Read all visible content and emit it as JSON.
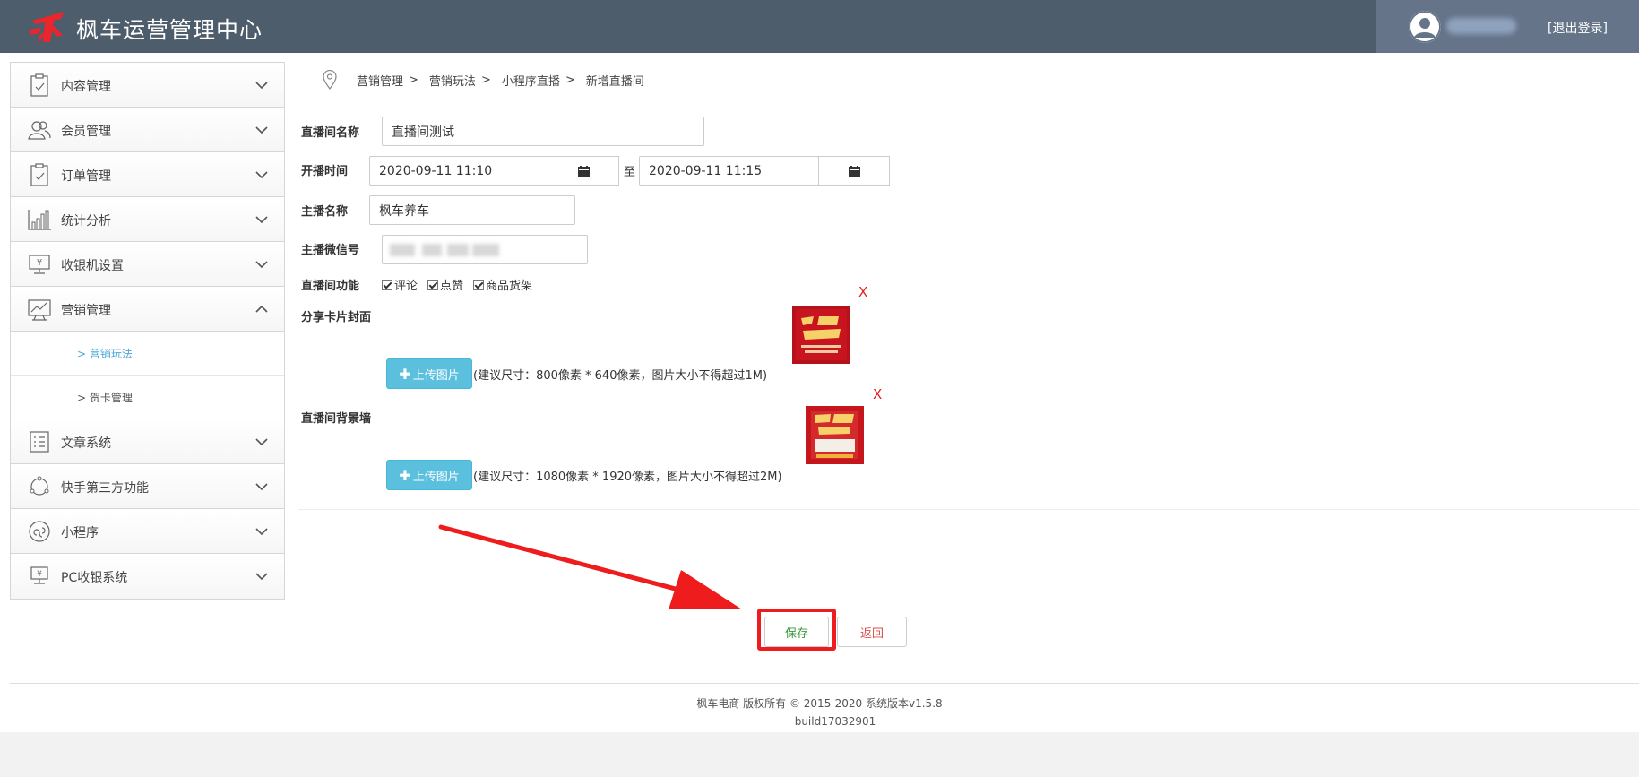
{
  "header": {
    "app_title": "枫车运营管理中心",
    "logout": "[退出登录]"
  },
  "sidebar": {
    "items": [
      {
        "label": "内容管理",
        "icon": "clipboard-check-icon",
        "expanded": false
      },
      {
        "label": "会员管理",
        "icon": "users-icon",
        "expanded": false
      },
      {
        "label": "订单管理",
        "icon": "clipboard-check-icon",
        "expanded": false
      },
      {
        "label": "统计分析",
        "icon": "bar-chart-icon",
        "expanded": false
      },
      {
        "label": "收银机设置",
        "icon": "cash-register-icon",
        "expanded": false
      },
      {
        "label": "营销管理",
        "icon": "trend-chart-icon",
        "expanded": true
      },
      {
        "label": "文章系统",
        "icon": "list-icon",
        "expanded": false
      },
      {
        "label": "快手第三方功能",
        "icon": "cycle-icon",
        "expanded": false
      },
      {
        "label": "小程序",
        "icon": "mini-program-icon",
        "expanded": false
      },
      {
        "label": "PC收银系统",
        "icon": "pc-cash-icon",
        "expanded": false
      }
    ],
    "submenu": [
      {
        "label": "> 营销玩法",
        "active": true
      },
      {
        "label": "> 贺卡管理",
        "active": false
      }
    ]
  },
  "breadcrumb": [
    "营销管理",
    "营销玩法",
    "小程序直播",
    "新增直播间"
  ],
  "breadcrumb_sep": ">",
  "form": {
    "room_name_label": "直播间名称",
    "room_name_value": "直播间测试",
    "start_time_label": "开播时间",
    "start_time_value": "2020-09-11 11:10",
    "to_text": "至",
    "end_time_value": "2020-09-11 11:15",
    "anchor_name_label": "主播名称",
    "anchor_name_value": "枫车养车",
    "anchor_wechat_label": "主播微信号",
    "features_label": "直播间功能",
    "features": [
      {
        "label": "评论",
        "checked": true
      },
      {
        "label": "点赞",
        "checked": true
      },
      {
        "label": "商品货架",
        "checked": true
      }
    ],
    "share_cover_label": "分享卡片封面",
    "background_label": "直播间背景墙",
    "upload_label": "上传图片",
    "share_cover_hint": "(建议尺寸：800像素 * 640像素，图片大小不得超过1M)",
    "background_hint": "(建议尺寸：1080像素 * 1920像素，图片大小不得超过2M)",
    "remove_text": "X"
  },
  "actions": {
    "save": "保存",
    "back": "返回"
  },
  "footer": {
    "copyright": "枫车电商 版权所有 © 2015-2020 系统版本v1.5.8",
    "build": "build17032901"
  },
  "colors": {
    "header_bg": "#4e5d6c",
    "upload_btn": "#5bc0de",
    "annotation_red": "#ee1c1c",
    "active_sub": "#48a9d6"
  }
}
